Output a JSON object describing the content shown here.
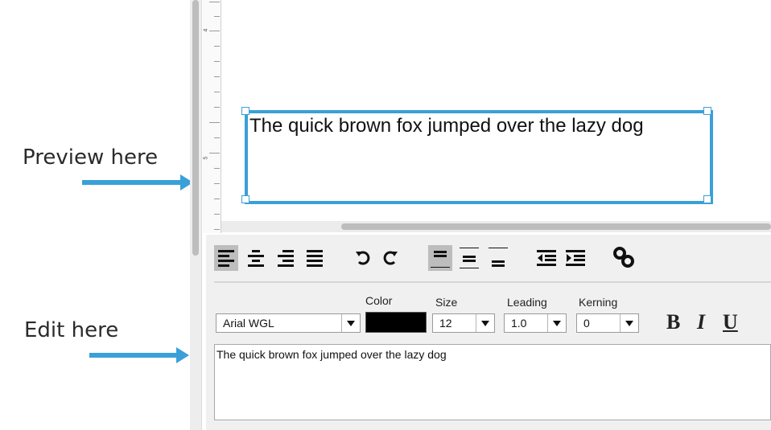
{
  "callouts": {
    "preview_label": "Preview here",
    "edit_label": "Edit here"
  },
  "ruler": {
    "numbers": [
      "4",
      "5"
    ]
  },
  "preview": {
    "text": "The quick brown fox jumped over the lazy dog"
  },
  "toolbar": {
    "buttons": [
      "align-left",
      "align-center",
      "align-right",
      "justify",
      "undo",
      "redo",
      "valign-top",
      "valign-middle",
      "valign-bottom",
      "outdent",
      "indent",
      "link"
    ],
    "active": [
      "align-left",
      "valign-top"
    ]
  },
  "format": {
    "font": {
      "value": "Arial WGL"
    },
    "color": {
      "label": "Color",
      "value": "#000000"
    },
    "size": {
      "label": "Size",
      "value": "12"
    },
    "leading": {
      "label": "Leading",
      "value": "1.0"
    },
    "kerning": {
      "label": "Kerning",
      "value": "0"
    },
    "bold": "B",
    "italic": "I",
    "underline": "U"
  },
  "editor": {
    "text": "The quick brown fox jumped over the lazy dog"
  },
  "colors": {
    "accent": "#3aa0d8"
  }
}
